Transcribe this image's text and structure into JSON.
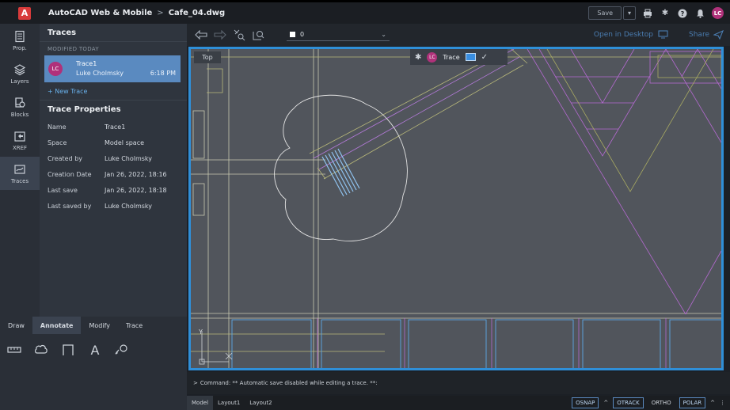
{
  "app": {
    "logo_letter": "A",
    "name": "AutoCAD Web & Mobile",
    "breadcrumb_sep": ">",
    "file_name": "Cafe_04.dwg"
  },
  "topbar": {
    "save_label": "Save",
    "user_initials": "LC"
  },
  "rail": {
    "items": [
      {
        "label": "Prop.",
        "icon": "properties-icon"
      },
      {
        "label": "Layers",
        "icon": "layers-icon"
      },
      {
        "label": "Blocks",
        "icon": "blocks-icon"
      },
      {
        "label": "XREF",
        "icon": "xref-icon"
      },
      {
        "label": "Traces",
        "icon": "traces-icon"
      }
    ]
  },
  "traces_panel": {
    "title": "Traces",
    "section_label": "MODIFIED TODAY",
    "trace": {
      "initials": "LC",
      "name": "Trace1",
      "author": "Luke Cholmsky",
      "time": "6:18 PM"
    },
    "new_trace": "+ New Trace",
    "props_title": "Trace Properties",
    "properties": [
      {
        "key": "Name",
        "value": "Trace1"
      },
      {
        "key": "Space",
        "value": "Model space"
      },
      {
        "key": "Created by",
        "value": "Luke Cholmsky"
      },
      {
        "key": "Creation Date",
        "value": "Jan 26, 2022, 18:16"
      },
      {
        "key": "Last save",
        "value": "Jan 26, 2022, 18:18"
      },
      {
        "key": "Last saved by",
        "value": "Luke Cholmsky"
      }
    ]
  },
  "tools": {
    "tabs": [
      "Draw",
      "Annotate",
      "Modify",
      "Trace"
    ],
    "active_tab": "Annotate",
    "text_tool_glyph": "A"
  },
  "canvas_toolbar": {
    "layer_name": "0",
    "open_desktop": "Open in Desktop",
    "share": "Share"
  },
  "drawing": {
    "view_label": "Top",
    "trace_bar": {
      "initials": "LC",
      "label": "Trace"
    }
  },
  "command_line": {
    "prompt": ">",
    "text": "Command: ** Automatic save disabled while editing a trace. **:"
  },
  "status_bar": {
    "layouts": [
      "Model",
      "Layout1",
      "Layout2"
    ],
    "active_layout": "Model",
    "toggles": [
      {
        "label": "OSNAP",
        "on": true
      },
      {
        "label": "OTRACK",
        "on": true
      },
      {
        "label": "ORTHO",
        "on": false
      },
      {
        "label": "POLAR",
        "on": true
      }
    ]
  },
  "colors": {
    "accent": "#2f8fd8",
    "selection": "#5a8ac0",
    "avatar": "#b0317a",
    "logo": "#d83b3b"
  }
}
